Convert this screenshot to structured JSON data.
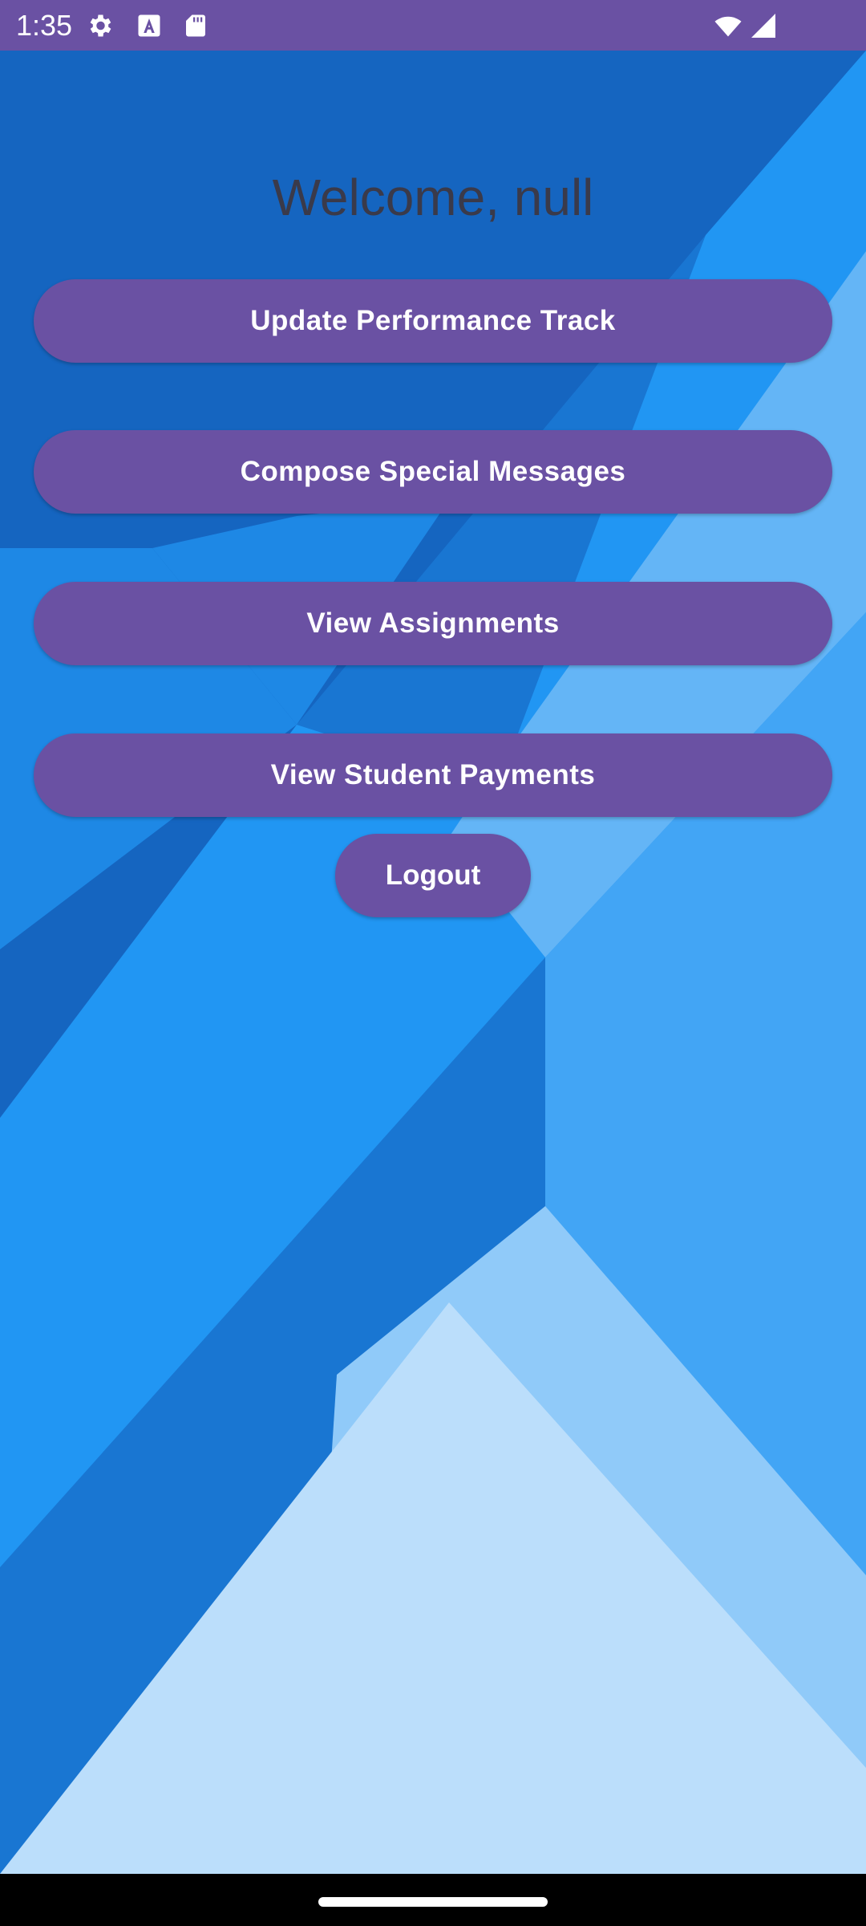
{
  "status_bar": {
    "time": "1:35",
    "left_icons": [
      "gear-icon",
      "text-a-icon",
      "sd-card-icon"
    ],
    "right_icons": [
      "wifi-icon",
      "cell-signal-icon"
    ]
  },
  "main": {
    "welcome_text": "Welcome, null",
    "buttons": [
      {
        "label": "Update Performance Track"
      },
      {
        "label": "Compose Special Messages"
      },
      {
        "label": "View Assignments"
      },
      {
        "label": "View Student Payments"
      }
    ],
    "logout_label": "Logout"
  },
  "colors": {
    "accent": "#6a51a3",
    "background_dark_blue": "#1565c0",
    "background_blue": "#1e88e5",
    "background_light_blue": "#64b5f6",
    "background_pale_blue": "#bbdefb"
  }
}
